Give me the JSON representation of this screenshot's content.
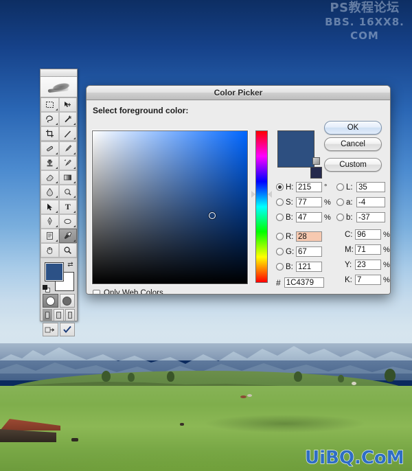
{
  "desktop": {
    "watermark_top_line1": "PS教程论坛",
    "watermark_top_line2": "BBS. 16XX8. COM",
    "watermark_bottom": "UiBQ.CoM"
  },
  "toolbar": {
    "name": "photoshop-tools-palette",
    "tools": [
      {
        "id": "marquee",
        "glyph": "▢"
      },
      {
        "id": "move",
        "glyph": "✥"
      },
      {
        "id": "lasso",
        "glyph": "✑"
      },
      {
        "id": "magic-wand",
        "glyph": "✦"
      },
      {
        "id": "crop",
        "glyph": "⌗"
      },
      {
        "id": "slice",
        "glyph": "✂"
      },
      {
        "id": "healing-brush",
        "glyph": "⚕"
      },
      {
        "id": "brush",
        "glyph": "✎"
      },
      {
        "id": "clone-stamp",
        "glyph": "♟"
      },
      {
        "id": "history-brush",
        "glyph": "✧"
      },
      {
        "id": "eraser",
        "glyph": "▱"
      },
      {
        "id": "gradient",
        "glyph": "▦"
      },
      {
        "id": "blur",
        "glyph": "◐"
      },
      {
        "id": "dodge",
        "glyph": "◓"
      },
      {
        "id": "path-selection",
        "glyph": "➤"
      },
      {
        "id": "type",
        "glyph": "T"
      },
      {
        "id": "pen",
        "glyph": "✒"
      },
      {
        "id": "shape",
        "glyph": "⬭"
      },
      {
        "id": "notes",
        "glyph": "▤"
      },
      {
        "id": "eyedropper",
        "glyph": "⟋",
        "selected": true
      },
      {
        "id": "hand",
        "glyph": "✋"
      },
      {
        "id": "zoom",
        "glyph": "⚲"
      }
    ],
    "foreground_color": "#2C5186",
    "background_color": "#FFFFFF",
    "swap_glyph": "⇄",
    "quick_mask_labels": [
      "standard-mode",
      "quick-mask-mode"
    ],
    "screen_modes": [
      "standard-screen",
      "full-screen-menubar",
      "full-screen"
    ],
    "jump_to": [
      "jump-to-imageready",
      "done-check"
    ]
  },
  "dialog": {
    "title": "Color Picker",
    "label": "Select foreground color:",
    "buttons": {
      "ok": "OK",
      "cancel": "Cancel",
      "custom": "Custom"
    },
    "preview": {
      "new_color": "#2D4F80",
      "current_color": "#252A4D",
      "gamut_icon": "web-safe-cube-icon"
    },
    "hsb": [
      {
        "key": "H",
        "label": "H:",
        "value": "215",
        "unit": "°",
        "selected": true
      },
      {
        "key": "S",
        "label": "S:",
        "value": "77",
        "unit": "%",
        "selected": false
      },
      {
        "key": "B",
        "label": "B:",
        "value": "47",
        "unit": "%",
        "selected": false
      }
    ],
    "lab": [
      {
        "key": "L",
        "label": "L:",
        "value": "35",
        "unit": "",
        "selected": false
      },
      {
        "key": "a",
        "label": "a:",
        "value": "-4",
        "unit": "",
        "selected": false
      },
      {
        "key": "b",
        "label": "b:",
        "value": "-37",
        "unit": "",
        "selected": false
      }
    ],
    "rgb": [
      {
        "key": "R",
        "label": "R:",
        "value": "28",
        "unit": "",
        "selected": false,
        "highlighted": true
      },
      {
        "key": "G",
        "label": "G:",
        "value": "67",
        "unit": "",
        "selected": false,
        "highlighted": false
      },
      {
        "key": "B",
        "label": "B:",
        "value": "121",
        "unit": "",
        "selected": false,
        "highlighted": false
      }
    ],
    "cmyk": [
      {
        "key": "C",
        "label": "C:",
        "value": "96",
        "unit": "%"
      },
      {
        "key": "M",
        "label": "M:",
        "value": "71",
        "unit": "%"
      },
      {
        "key": "Y",
        "label": "Y:",
        "value": "23",
        "unit": "%"
      },
      {
        "key": "K",
        "label": "K:",
        "value": "7",
        "unit": "%"
      }
    ],
    "hex": {
      "prefix": "#",
      "value": "1C4379"
    },
    "only_web_colors": {
      "label": "Only Web Colors",
      "checked": false
    }
  }
}
